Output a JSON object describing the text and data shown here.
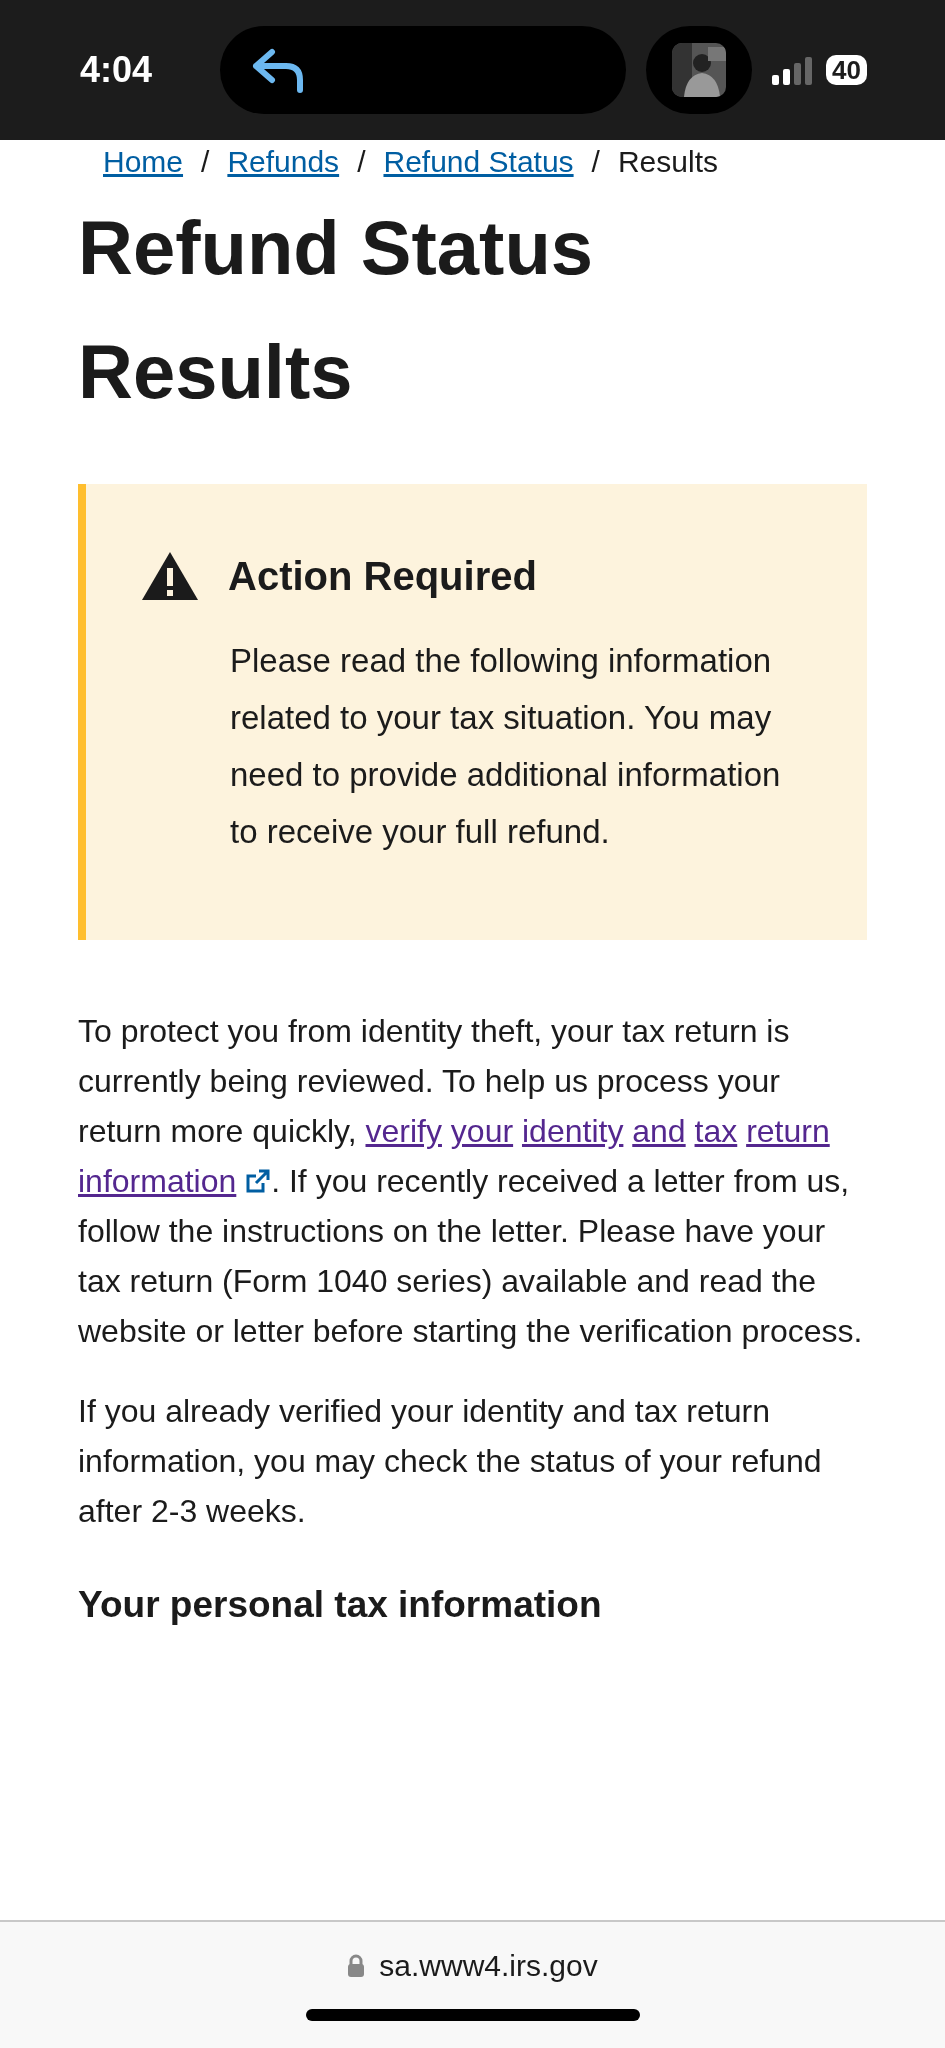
{
  "status_bar": {
    "time": "4:04",
    "battery": "40"
  },
  "breadcrumb": [
    {
      "label": "Home",
      "kind": "link"
    },
    {
      "separator": "/",
      "label": "Refunds",
      "kind": "link"
    },
    {
      "separator": "/",
      "label": "Refund Status",
      "kind": "link"
    },
    {
      "separator": "/",
      "label": "Results",
      "kind": "current"
    }
  ],
  "title": "Refund Status Results",
  "alert": {
    "title": "Action Required",
    "body": "Please read the following information related to your tax situation. You may need to provide additional information to receive your full refund."
  },
  "paragraphs": [
    {
      "before": "To protect you from identity theft, your tax return is currently being reviewed. To help us process your return more quickly, ",
      "link": "verify your identity and tax return information",
      "after": ". If you recently received a letter from us, follow the instructions on the letter. Please have your tax return (Form 1040 series) available and read the website or letter before starting the verification process."
    },
    {
      "before": "If you already verified your identity and tax return information, you may check the status of your refund after 2-3 weeks."
    }
  ],
  "section_heading": "Your personal tax information",
  "url_bar": {
    "url": "sa.www4.irs.gov"
  }
}
